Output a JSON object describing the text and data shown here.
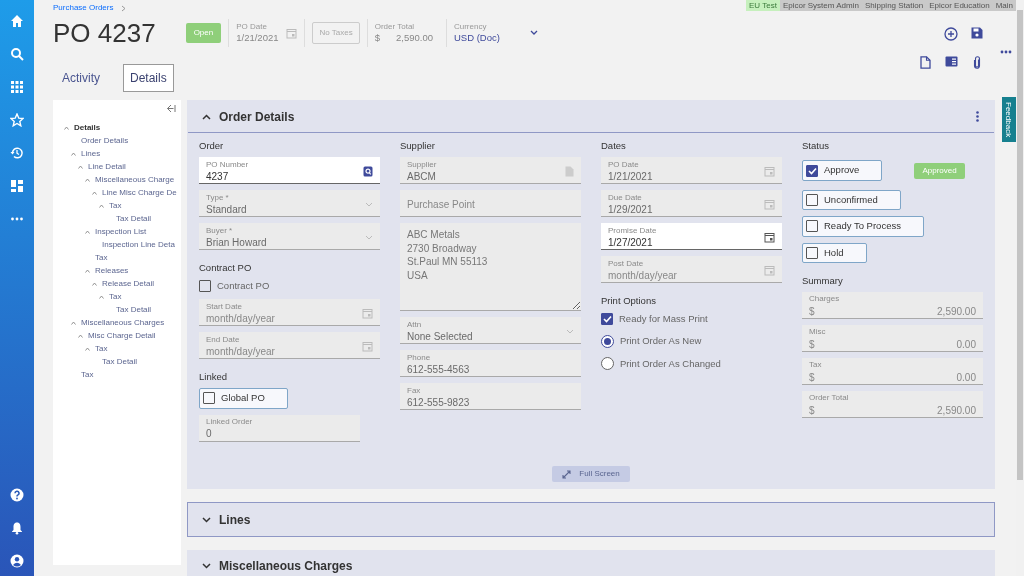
{
  "environment_tags": [
    {
      "label": "EU Test",
      "selected": true
    },
    {
      "label": "Epicor System Admin",
      "selected": false
    },
    {
      "label": "Shipping Station",
      "selected": false
    },
    {
      "label": "Epicor Education",
      "selected": false
    },
    {
      "label": "Main",
      "selected": false
    }
  ],
  "breadcrumb": [
    "Purchase Orders"
  ],
  "header": {
    "title": "PO 4237",
    "status": "Open",
    "po_date": {
      "label": "PO Date",
      "value": "1/21/2021"
    },
    "taxes": "No Taxes",
    "order_total": {
      "label": "Order Total",
      "currency": "$",
      "value": "2,590.00"
    },
    "currency": {
      "label": "Currency",
      "value": "USD (Doc)"
    }
  },
  "tabs": [
    {
      "label": "Activity",
      "selected": false
    },
    {
      "label": "Details",
      "selected": true
    }
  ],
  "tree": [
    {
      "label": "Details",
      "expanded": true,
      "children": [
        {
          "label": "Order Details"
        },
        {
          "label": "Lines",
          "expanded": true,
          "children": [
            {
              "label": "Line Detail",
              "expanded": true,
              "children": [
                {
                  "label": "Miscellaneous Charge",
                  "expanded": true,
                  "children": [
                    {
                      "label": "Line Misc Charge De",
                      "expanded": true,
                      "children": [
                        {
                          "label": "Tax",
                          "expanded": true,
                          "children": [
                            {
                              "label": "Tax Detail"
                            }
                          ]
                        }
                      ]
                    }
                  ]
                },
                {
                  "label": "Inspection List",
                  "expanded": true,
                  "children": [
                    {
                      "label": "Inspection Line Deta"
                    }
                  ]
                },
                {
                  "label": "Tax"
                },
                {
                  "label": "Releases",
                  "expanded": true,
                  "children": [
                    {
                      "label": "Release Detail",
                      "expanded": true,
                      "children": [
                        {
                          "label": "Tax",
                          "expanded": true,
                          "children": [
                            {
                              "label": "Tax Detail"
                            }
                          ]
                        }
                      ]
                    }
                  ]
                }
              ]
            }
          ]
        },
        {
          "label": "Miscellaneous Charges",
          "expanded": true,
          "children": [
            {
              "label": "Misc Charge Detail",
              "expanded": true,
              "children": [
                {
                  "label": "Tax",
                  "expanded": true,
                  "children": [
                    {
                      "label": "Tax Detail"
                    }
                  ]
                }
              ]
            }
          ]
        },
        {
          "label": "Tax"
        }
      ]
    }
  ],
  "sections": [
    {
      "title": "Order Details",
      "expanded": true,
      "focused": false,
      "full_screen": "Full Screen",
      "columns": [
        [
          {
            "kind": "heading",
            "text": "Order"
          },
          {
            "kind": "lookup",
            "label": "PO Number",
            "value": "4237",
            "active": true
          },
          {
            "kind": "select",
            "label": "Type *",
            "value": "Standard",
            "active": false
          },
          {
            "kind": "select",
            "label": "Buyer *",
            "value": "Brian Howard",
            "active": false
          },
          {
            "kind": "heading",
            "text": "Contract PO"
          },
          {
            "kind": "check",
            "label": "Contract PO",
            "checked": false,
            "boxed": false
          },
          {
            "kind": "date",
            "label": "Start Date",
            "placeholder": "month/day/year",
            "active": false
          },
          {
            "kind": "date",
            "label": "End Date",
            "placeholder": "month/day/year",
            "active": false
          },
          {
            "kind": "heading",
            "text": "Linked"
          },
          {
            "kind": "check",
            "label": "Global PO",
            "checked": false,
            "boxed": true
          },
          {
            "kind": "field",
            "label": "Linked Order",
            "value": "0",
            "active": false,
            "narrow": true
          }
        ],
        [
          {
            "kind": "heading",
            "text": "Supplier"
          },
          {
            "kind": "reference",
            "label": "Supplier",
            "value": "ABCM",
            "active": false
          },
          {
            "kind": "field",
            "placeholder": "Purchase Point",
            "active": false
          },
          {
            "kind": "textarea",
            "lines": [
              "ABC Metals",
              "2730 Broadway",
              "St.Paul MN 55113",
              "USA"
            ]
          },
          {
            "kind": "select",
            "label": "Attn",
            "value": "None Selected",
            "active": false
          },
          {
            "kind": "field",
            "label": "Phone",
            "value": "612-555-4563",
            "active": false
          },
          {
            "kind": "field",
            "label": "Fax",
            "value": "612-555-9823",
            "active": false
          }
        ],
        [
          {
            "kind": "heading",
            "text": "Dates"
          },
          {
            "kind": "date",
            "label": "PO Date",
            "value": "1/21/2021",
            "active": false
          },
          {
            "kind": "date",
            "label": "Due Date",
            "value": "1/29/2021",
            "active": false
          },
          {
            "kind": "date",
            "label": "Promise Date",
            "value": "1/27/2021",
            "active": true
          },
          {
            "kind": "date",
            "label": "Post Date",
            "placeholder": "month/day/year",
            "active": false
          },
          {
            "kind": "heading",
            "text": "Print Options"
          },
          {
            "kind": "check",
            "label": "Ready for Mass Print",
            "checked": true,
            "boxed": false
          },
          {
            "kind": "radio",
            "label": "Print Order As New",
            "selected": true
          },
          {
            "kind": "radio",
            "label": "Print Order As Changed",
            "selected": false
          }
        ],
        [
          {
            "kind": "heading",
            "text": "Status"
          },
          {
            "kind": "check",
            "label": "Approve",
            "checked": true,
            "boxed": true,
            "badge": "Approved"
          },
          {
            "kind": "check",
            "label": "Unconfirmed",
            "checked": false,
            "boxed": true
          },
          {
            "kind": "check",
            "label": "Ready To Process",
            "checked": false,
            "boxed": true
          },
          {
            "kind": "check",
            "label": "Hold",
            "checked": false,
            "boxed": true
          },
          {
            "kind": "heading",
            "text": "Summary"
          },
          {
            "kind": "money",
            "label": "Charges",
            "currency": "$",
            "value": "2,590.00"
          },
          {
            "kind": "money",
            "label": "Misc",
            "currency": "$",
            "value": "0.00"
          },
          {
            "kind": "money",
            "label": "Tax",
            "currency": "$",
            "value": "0.00"
          },
          {
            "kind": "money",
            "label": "Order Total",
            "currency": "$",
            "value": "2,590.00"
          }
        ]
      ]
    },
    {
      "title": "Lines",
      "expanded": false,
      "focused": true
    },
    {
      "title": "Miscellaneous Charges",
      "expanded": false,
      "focused": false
    }
  ],
  "feedback_tab": "Feedback"
}
